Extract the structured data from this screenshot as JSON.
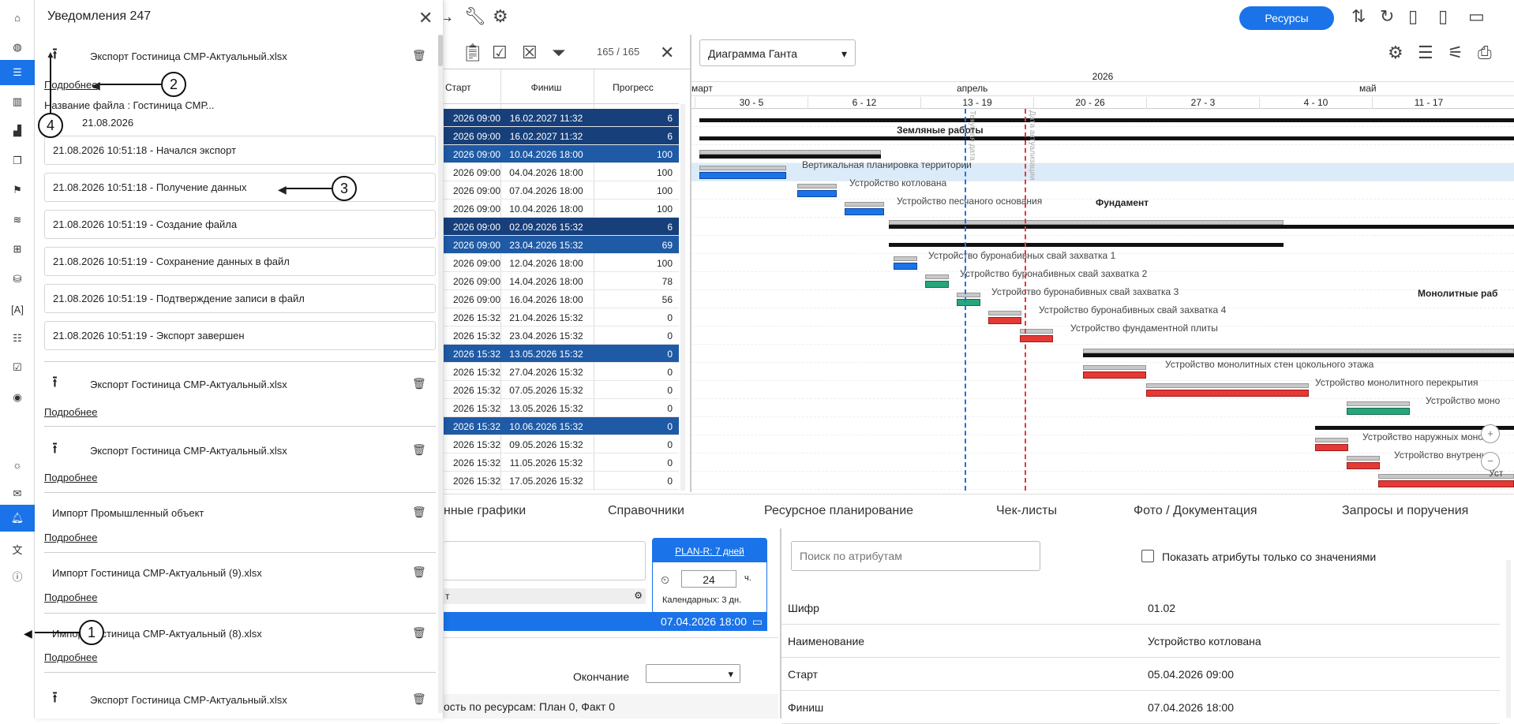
{
  "notifications": {
    "title": "Уведомления 247",
    "items": [
      {
        "title": "Экспорт Гостиница СМР-Актуальный.xlsx",
        "more": "Подробнее"
      },
      {
        "title": "Экспорт Гостиница СМР-Актуальный.xlsx",
        "more": "Подробнее"
      },
      {
        "title": "Экспорт Гостиница СМР-Актуальный.xlsx",
        "more": "Подробнее"
      },
      {
        "title": "Импорт Промышленный объект",
        "more": "Подробнее"
      },
      {
        "title": "Импорт Гостиница СМР-Актуальный (9).xlsx",
        "more": "Подробнее"
      },
      {
        "title": "Импорт Гостиница СМР-Актуальный (8).xlsx",
        "more": "Подробнее"
      },
      {
        "title": "Экспорт Гостиница СМР-Актуальный.xlsx"
      }
    ],
    "first_details": {
      "file_name": "Название файла :  Гостиница СМР...",
      "date_label": "Д",
      "date_value": "21.08.2026"
    },
    "log": [
      "21.08.2026 10:51:18 - Начался экспорт",
      "21.08.2026 10:51:18 - Получение данных",
      "21.08.2026 10:51:19 - Создание файла",
      "21.08.2026 10:51:19 - Сохранение данных в файл",
      "21.08.2026 10:51:19 - Подтверждение записи в файл",
      "21.08.2026 10:51:19 - Экспорт завершен"
    ],
    "callouts": [
      "1",
      "2",
      "3",
      "4"
    ]
  },
  "toolbar": {
    "resources": "Ресурсы",
    "filter_count": "165 / 165"
  },
  "table": {
    "headers": [
      "Старт",
      "Финиш",
      "Прогресс"
    ],
    "rows": [
      {
        "start": "2026 09:00",
        "finish": "16.02.2027 11:32",
        "progress": "6",
        "style": "darker"
      },
      {
        "start": "2026 09:00",
        "finish": "16.02.2027 11:32",
        "progress": "6",
        "style": "darker"
      },
      {
        "start": "2026 09:00",
        "finish": "10.04.2026 18:00",
        "progress": "100",
        "style": "dark"
      },
      {
        "start": "2026 09:00",
        "finish": "04.04.2026 18:00",
        "progress": "100",
        "style": ""
      },
      {
        "start": "2026 09:00",
        "finish": "07.04.2026 18:00",
        "progress": "100",
        "style": ""
      },
      {
        "start": "2026 09:00",
        "finish": "10.04.2026 18:00",
        "progress": "100",
        "style": ""
      },
      {
        "start": "2026 09:00",
        "finish": "02.09.2026 15:32",
        "progress": "6",
        "style": "darker"
      },
      {
        "start": "2026 09:00",
        "finish": "23.04.2026 15:32",
        "progress": "69",
        "style": "dark"
      },
      {
        "start": "2026 09:00",
        "finish": "12.04.2026 18:00",
        "progress": "100",
        "style": ""
      },
      {
        "start": "2026 09:00",
        "finish": "14.04.2026 18:00",
        "progress": "78",
        "style": ""
      },
      {
        "start": "2026 09:00",
        "finish": "16.04.2026 18:00",
        "progress": "56",
        "style": ""
      },
      {
        "start": "2026 15:32",
        "finish": "21.04.2026 15:32",
        "progress": "0",
        "style": ""
      },
      {
        "start": "2026 15:32",
        "finish": "23.04.2026 15:32",
        "progress": "0",
        "style": ""
      },
      {
        "start": "2026 15:32",
        "finish": "13.05.2026 15:32",
        "progress": "0",
        "style": "dark"
      },
      {
        "start": "2026 15:32",
        "finish": "27.04.2026 15:32",
        "progress": "0",
        "style": ""
      },
      {
        "start": "2026 15:32",
        "finish": "07.05.2026 15:32",
        "progress": "0",
        "style": ""
      },
      {
        "start": "2026 15:32",
        "finish": "13.05.2026 15:32",
        "progress": "0",
        "style": ""
      },
      {
        "start": "2026 15:32",
        "finish": "10.06.2026 15:32",
        "progress": "0",
        "style": "dark"
      },
      {
        "start": "2026 15:32",
        "finish": "09.05.2026 15:32",
        "progress": "0",
        "style": ""
      },
      {
        "start": "2026 15:32",
        "finish": "11.05.2026 15:32",
        "progress": "0",
        "style": ""
      },
      {
        "start": "2026 15:32",
        "finish": "17.05.2026 15:32",
        "progress": "0",
        "style": ""
      }
    ]
  },
  "gantt": {
    "view": "Диаграмма Ганта",
    "year": "2026",
    "months": [
      "март",
      "апрель",
      "май"
    ],
    "weeks": [
      "30 - 5",
      "6 - 12",
      "13 - 19",
      "20 - 26",
      "27 - 3",
      "4 - 10",
      "11 - 17"
    ],
    "today_label": "Текущая дата",
    "actualization_label": "Дата актуализации",
    "tasks": [
      {
        "name": "Земляные работы",
        "bold": true
      },
      {
        "name": "Вертикальная планировка территории"
      },
      {
        "name": "Устройство котлована"
      },
      {
        "name": "Устройство песчаного основания"
      },
      {
        "name": "Фундамент",
        "bold": true
      },
      {
        "name": "Устройство буронабивных свай захватка 1"
      },
      {
        "name": "Устройство буронабивных свай захватка 2"
      },
      {
        "name": "Устройство буронабивных свай захватка 3"
      },
      {
        "name": "Устройство буронабивных свай захватка 4"
      },
      {
        "name": "Устройство фундаментной плиты"
      },
      {
        "name": "Монолитные раб",
        "bold": true
      },
      {
        "name": "Устройство монолитных стен цокольного этажа"
      },
      {
        "name": "Устройство монолитного перекрытия"
      },
      {
        "name": "Устройство моно"
      },
      {
        "name": "Устройство наружных монолит"
      },
      {
        "name": "Устройство внутренн"
      },
      {
        "name": "Уст"
      }
    ]
  },
  "bottom_tabs": [
    "нные графики",
    "Справочники",
    "Ресурсное планирование",
    "Чек-листы",
    "Фото / Документация",
    "Запросы и поручения"
  ],
  "form": {
    "plan_link": "PLAN-R: 7 дней",
    "duration": "24",
    "duration_unit": "ч.",
    "calendar": "Календарных:  3 дн.",
    "field_suffix": "т",
    "end_date": "07.04.2026 18:00",
    "end_label": "Окончание",
    "resource_status": "ость по ресурсам: План 0, Факт 0"
  },
  "attributes": {
    "search_placeholder": "Поиск по атрибутам",
    "only_values": "Показать атрибуты только со значениями",
    "rows": [
      {
        "key": "Шифр",
        "value": "01.02"
      },
      {
        "key": "Наименование",
        "value": "Устройство котлована"
      },
      {
        "key": "Старт",
        "value": "05.04.2026 09:00"
      },
      {
        "key": "Финиш",
        "value": "07.04.2026 18:00"
      }
    ]
  },
  "colors": {
    "accent": "#1a73e8",
    "red": "#e53935",
    "green": "#26a67a"
  }
}
